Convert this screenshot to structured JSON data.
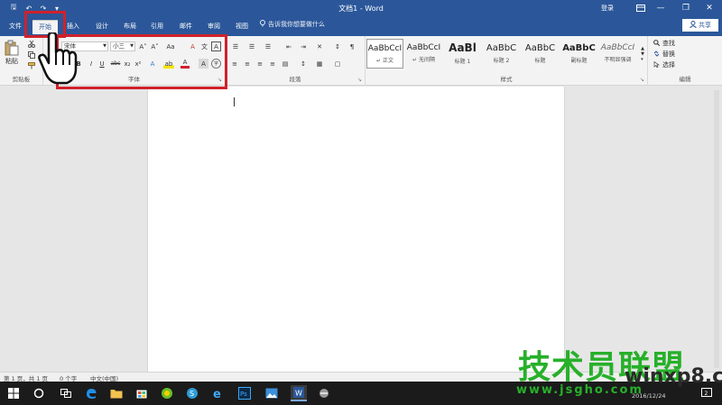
{
  "window": {
    "title": "文档1 - Word",
    "login": "登录",
    "restore_icon": "ribbon-display-icon",
    "min_glyph": "—",
    "max_glyph": "❐",
    "close_glyph": "✕"
  },
  "quick_access": {
    "save_glyph": "🖫",
    "undo_glyph": "↶",
    "redo_glyph": "↷",
    "more_glyph": "▾"
  },
  "tabs": [
    {
      "label": "文件"
    },
    {
      "label": "开始"
    },
    {
      "label": "插入"
    },
    {
      "label": "设计"
    },
    {
      "label": "布局"
    },
    {
      "label": "引用"
    },
    {
      "label": "邮件"
    },
    {
      "label": "审阅"
    },
    {
      "label": "视图"
    }
  ],
  "tell_me": "告诉我你想要做什么",
  "share": {
    "label": "共享",
    "glyph": "👤"
  },
  "clipboard": {
    "label": "剪贴板",
    "paste_label": "粘贴",
    "paste_glyph": "📋"
  },
  "font": {
    "label": "字体",
    "font_name": "宋体",
    "font_size": "小三",
    "grow_glyph": "A˄",
    "shrink_glyph": "A˅",
    "case_glyph": "Aa",
    "clear_glyph": "A",
    "pinyin_glyph": "文",
    "border_glyph": "A",
    "bold": "B",
    "italic": "I",
    "underline": "U",
    "strike": "abc",
    "sub": "x₂",
    "sup": "x²",
    "effect_glyph": "A",
    "highlight_glyph": "ab",
    "color_glyph": "A",
    "shade_glyph": "A",
    "enclose_glyph": "字"
  },
  "paragraph": {
    "label": "段落",
    "row1": [
      "☰",
      "☰",
      "☰",
      "⇤",
      "⇥",
      "✕",
      "↕",
      "¶"
    ],
    "row2": [
      "≡",
      "≡",
      "≡",
      "≡",
      "▤",
      "↕",
      "▦",
      "▢"
    ]
  },
  "styles": {
    "label": "样式",
    "items": [
      {
        "sample": "AaBbCcI",
        "name": "↵ 正文"
      },
      {
        "sample": "AaBbCcI",
        "name": "↵ 无间隔"
      },
      {
        "sample": "AaBl",
        "name": "标题 1"
      },
      {
        "sample": "AaBbC",
        "name": "标题 2"
      },
      {
        "sample": "AaBbC",
        "name": "标题"
      },
      {
        "sample": "AaBbC",
        "name": "副标题"
      },
      {
        "sample": "AaBbCcI",
        "name": "不明显强调"
      }
    ]
  },
  "editing": {
    "label": "编辑",
    "find": "查找",
    "replace": "替换",
    "select": "选择"
  },
  "status": {
    "page": "第 1 页，共 1 页",
    "words": "0 个字",
    "lang": "中文(中国)"
  },
  "taskbar": {
    "date": "2016/12/24",
    "icons": [
      "windows-start",
      "cortana",
      "edge",
      "file-explorer",
      "store",
      "360-browser",
      "sogou",
      "ie",
      "photoshop",
      "photos",
      "word",
      "tool"
    ]
  },
  "watermark": {
    "cn": "技术员联盟",
    "en": "winxp8.com",
    "url": "www.jsgho.com"
  },
  "colors": {
    "word_blue": "#2b579a",
    "highlight_red": "#d0212b",
    "watermark_green": "#27b02a"
  }
}
